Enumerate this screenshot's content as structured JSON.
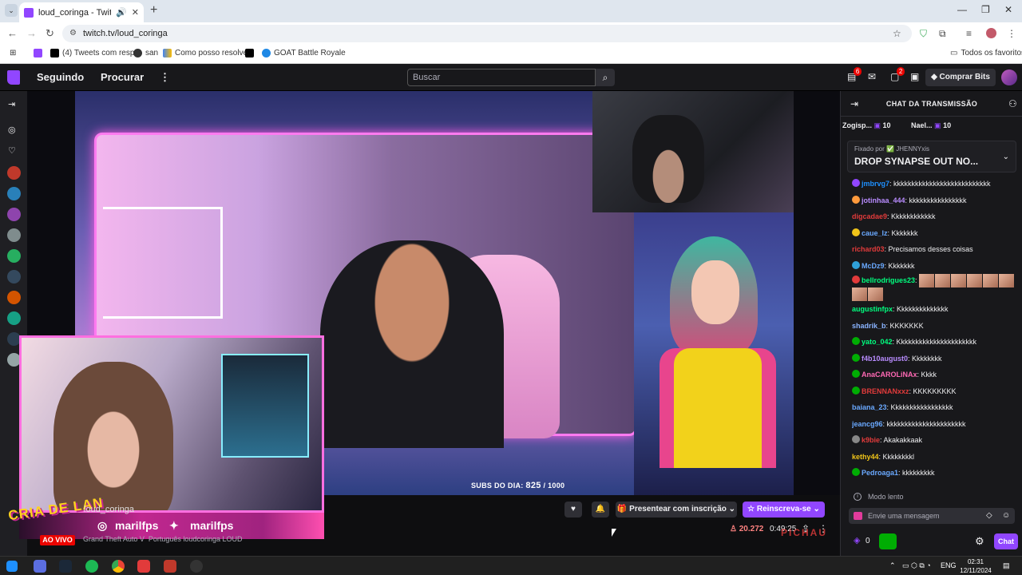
{
  "browser": {
    "tab_title": "loud_coringa - Twitch",
    "url": "twitch.tv/loud_coringa",
    "bookmarks": [
      "(4) Tweets com resp...",
      "san",
      "Como posso resolve...",
      "GOAT Battle Royale"
    ],
    "all_bookmarks": "Todos os favoritos"
  },
  "twitch_nav": {
    "following": "Seguindo",
    "browse": "Procurar",
    "search_placeholder": "Buscar",
    "notif_count": "6",
    "whisper_count": "2",
    "bits_button": "Comprar Bits"
  },
  "stream": {
    "subs_goal_label": "SUBS DO DIA:",
    "subs_goal_value": "825",
    "subs_goal_target": "/ 1000",
    "channel_name": "loud_coringa",
    "social_instagram": "marilfps",
    "social_twitter": "marilfps",
    "overlay_logo": "CRIA DE LAN",
    "live_label": "AO VIVO",
    "category": "Grand Theft Auto V",
    "tags": "Português   loudcoringa   LOUD",
    "gift_button": "Presentear com inscrição",
    "resub_button": "Reinscreva-se",
    "viewers": "20.272",
    "uptime": "0:49:25",
    "sponsor": "PICHAU"
  },
  "chat": {
    "header": "CHAT DA TRANSMISSÃO",
    "leaderboard": [
      {
        "name": "Zogisp...",
        "count": "10"
      },
      {
        "name": "Nael...",
        "count": "10"
      }
    ],
    "pinned_by": "Fixado por ✅ JHENNYxis",
    "pinned_msg": "DROP SYNAPSE OUT NO...",
    "messages": [
      {
        "user": "jmbrvg7",
        "text": "kkkkkkkkkkkkkkkkkkkkkkkkkkk",
        "color": "#1e90ff",
        "badge": "#9146ff"
      },
      {
        "user": "jotinhaa_444",
        "text": "kkkkkkkkkkkkkkkk",
        "color": "#b98cff",
        "badge": "#ff9a3c"
      },
      {
        "user": "digcadae9",
        "text": "Kkkkkkkkkkkk",
        "color": "#e23b3b",
        "badge": ""
      },
      {
        "user": "caue_lz",
        "text": "Kkkkkkk",
        "color": "#6aa9ff",
        "badge": "#f0c419"
      },
      {
        "user": "richard03",
        "text": "Precisamos desses coisas",
        "color": "#e23b3b",
        "badge": ""
      },
      {
        "user": "McDz9",
        "text": "Kkkkkkk",
        "color": "#6aa9ff",
        "badge": "#2fa0d8"
      },
      {
        "user": "bellrodrigues23",
        "text": "",
        "color": "#00ff7f",
        "badge": "#e23b3b",
        "emotes": 8
      },
      {
        "user": "augustinfpx",
        "text": "Kkkkkkkkkkkkkk",
        "color": "#00ff7f",
        "badge": ""
      },
      {
        "user": "shadrik_b",
        "text": "KKKKKKK",
        "color": "#8ab4ff",
        "badge": ""
      },
      {
        "user": "yato_042",
        "text": "Kkkkkkkkkkkkkkkkkkkkkk",
        "color": "#00ff7f",
        "badge": "#00ad03"
      },
      {
        "user": "f4b10august0",
        "text": "Kkkkkkkk",
        "color": "#b98cff",
        "badge": "#00ad03"
      },
      {
        "user": "AnaCAROLiNAx",
        "text": "Kkkk",
        "color": "#ff69b4",
        "badge": "#00ad03"
      },
      {
        "user": "BRENNANxxz",
        "text": "KKKKKKKKK",
        "color": "#e23b3b",
        "badge": "#00ad03"
      },
      {
        "user": "baiana_23",
        "text": "Kkkkkkkkkkkkkkkkk",
        "color": "#6aa9ff",
        "badge": ""
      },
      {
        "user": "jeancg96",
        "text": "kkkkkkkkkkkkkkkkkkkkkk",
        "color": "#6aa9ff",
        "badge": ""
      },
      {
        "user": "k9bie",
        "text": "Akakakkaak",
        "color": "#e23b3b",
        "badge": "#888888"
      },
      {
        "user": "kethy44",
        "text": "Kkkkkkkkl",
        "color": "#f0c419",
        "badge": ""
      },
      {
        "user": "Pedroaga1",
        "text": "kkkkkkkkk",
        "color": "#6aa9ff",
        "badge": "#00ad03"
      }
    ],
    "slow_mode": "Modo lento",
    "input_placeholder": "Envie uma mensagem",
    "points": "0",
    "chat_button": "Chat"
  },
  "taskbar": {
    "lang": "ENG",
    "time": "02:31",
    "date": "12/11/2024"
  },
  "colors": {
    "twitch_purple": "#9146ff",
    "bg": "#0e0e10",
    "live_red": "#eb0400"
  }
}
